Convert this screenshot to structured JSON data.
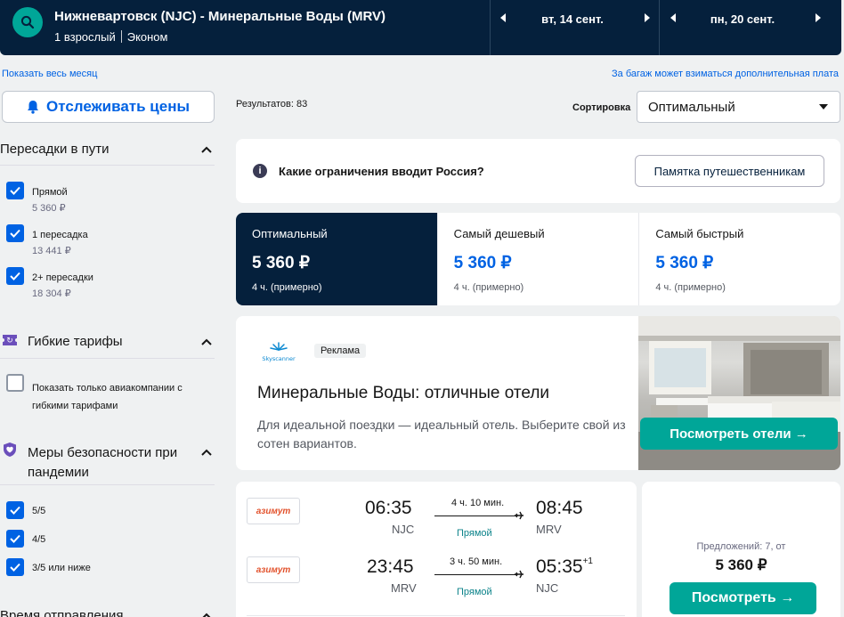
{
  "header": {
    "route": "Нижневартовск (NJC) - Минеральные Воды (MRV)",
    "passengers": "1 взрослый",
    "cabin": "Эконом",
    "depart_date": "вт, 14 сент.",
    "return_date": "пн, 20 сент.",
    "icons": [
      "search-icon",
      "chevron-left-icon",
      "chevron-right-icon"
    ]
  },
  "links": {
    "show_month": "Показать весь месяц",
    "baggage_note": "За багаж может взиматься дополнительная плата"
  },
  "track_prices": {
    "label": "Отслеживать цены",
    "icon": "bell-icon"
  },
  "filters": {
    "stops": {
      "title": "Пересадки в пути",
      "options": [
        {
          "label": "Прямой",
          "price": "5 360 ₽",
          "checked": true
        },
        {
          "label": "1 пересадка",
          "price": "13 441 ₽",
          "checked": true
        },
        {
          "label": "2+ пересадки",
          "price": "18 304 ₽",
          "checked": true
        }
      ]
    },
    "flex": {
      "title": "Гибкие тарифы",
      "option": "Показать только авиакомпании с гибкими тарифами",
      "checked": false
    },
    "safety": {
      "title": "Меры безопасности при пандемии",
      "options": [
        {
          "label": "5/5",
          "checked": true
        },
        {
          "label": "4/5",
          "checked": true
        },
        {
          "label": "3/5 или ниже",
          "checked": true
        }
      ]
    },
    "departure_time": {
      "title": "Время отправления"
    }
  },
  "results": {
    "count": "Результатов: 83",
    "sort_label": "Сортировка",
    "sort_value": "Оптимальный"
  },
  "info": {
    "text": "Какие ограничения вводит Россия?",
    "button": "Памятка путешественникам"
  },
  "tabs": [
    {
      "name": "Оптимальный",
      "price": "5 360 ₽",
      "duration": "4 ч. (примерно)",
      "active": true
    },
    {
      "name": "Самый дешевый",
      "price": "5 360 ₽",
      "duration": "4 ч. (примерно)",
      "active": false
    },
    {
      "name": "Самый быстрый",
      "price": "5 360 ₽",
      "duration": "4 ч. (примерно)",
      "active": false
    }
  ],
  "ad": {
    "brand": "Skyscanner",
    "badge": "Реклама",
    "title": "Минеральные Воды: отличные отели",
    "description": "Для идеальной поездки — идеальный отель. Выберите свой из сотен вариантов.",
    "button": "Посмотреть отели →"
  },
  "flight": {
    "airline": "азимут",
    "legs": [
      {
        "dep_time": "06:35",
        "dep_code": "NJC",
        "duration": "4 ч. 10 мин.",
        "stops": "Прямой",
        "arr_time": "08:45",
        "arr_code": "MRV",
        "day_offset": ""
      },
      {
        "dep_time": "23:45",
        "dep_code": "MRV",
        "duration": "3 ч. 50 мин.",
        "stops": "Прямой",
        "arr_time": "05:35",
        "arr_code": "NJC",
        "day_offset": "+1"
      }
    ],
    "offers": "Предложений: 7, от",
    "price": "5 360 ₽",
    "button": "Посмотреть →"
  },
  "colors": {
    "header_bg": "#05203c",
    "accent_blue": "#0062e3",
    "accent_teal": "#00a698"
  }
}
